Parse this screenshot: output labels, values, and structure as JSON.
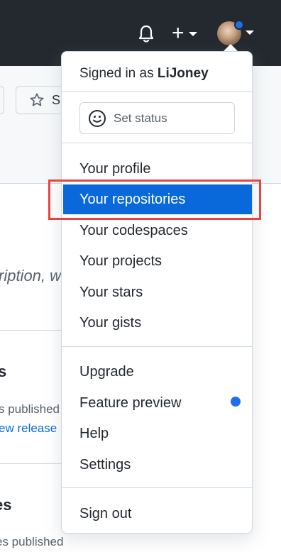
{
  "header": {
    "notifications_icon": "bell-icon",
    "create_icon": "plus-icon",
    "avatar_badge_color": "#1f6feb"
  },
  "background_page": {
    "star_button_label": "S",
    "description_fragment": "ription, w",
    "section1_heading": "s",
    "section1_text": "s published",
    "section1_link": "ew release",
    "section2_heading": "es",
    "section2_text": "es published"
  },
  "dropdown": {
    "signed_in_prefix": "Signed in as",
    "username": "LiJoney",
    "set_status_label": "Set status",
    "items": [
      {
        "label": "Your profile"
      },
      {
        "label": "Your repositories",
        "active": true
      },
      {
        "label": "Your codespaces"
      },
      {
        "label": "Your projects"
      },
      {
        "label": "Your stars"
      },
      {
        "label": "Your gists"
      },
      {
        "label": "Upgrade"
      },
      {
        "label": "Feature preview",
        "badge": "dot"
      },
      {
        "label": "Help"
      },
      {
        "label": "Settings"
      },
      {
        "label": "Sign out"
      }
    ]
  },
  "colors": {
    "header_bg": "#24292f",
    "active_bg": "#0969da",
    "highlight_border": "#e5443f",
    "link": "#0969da"
  }
}
